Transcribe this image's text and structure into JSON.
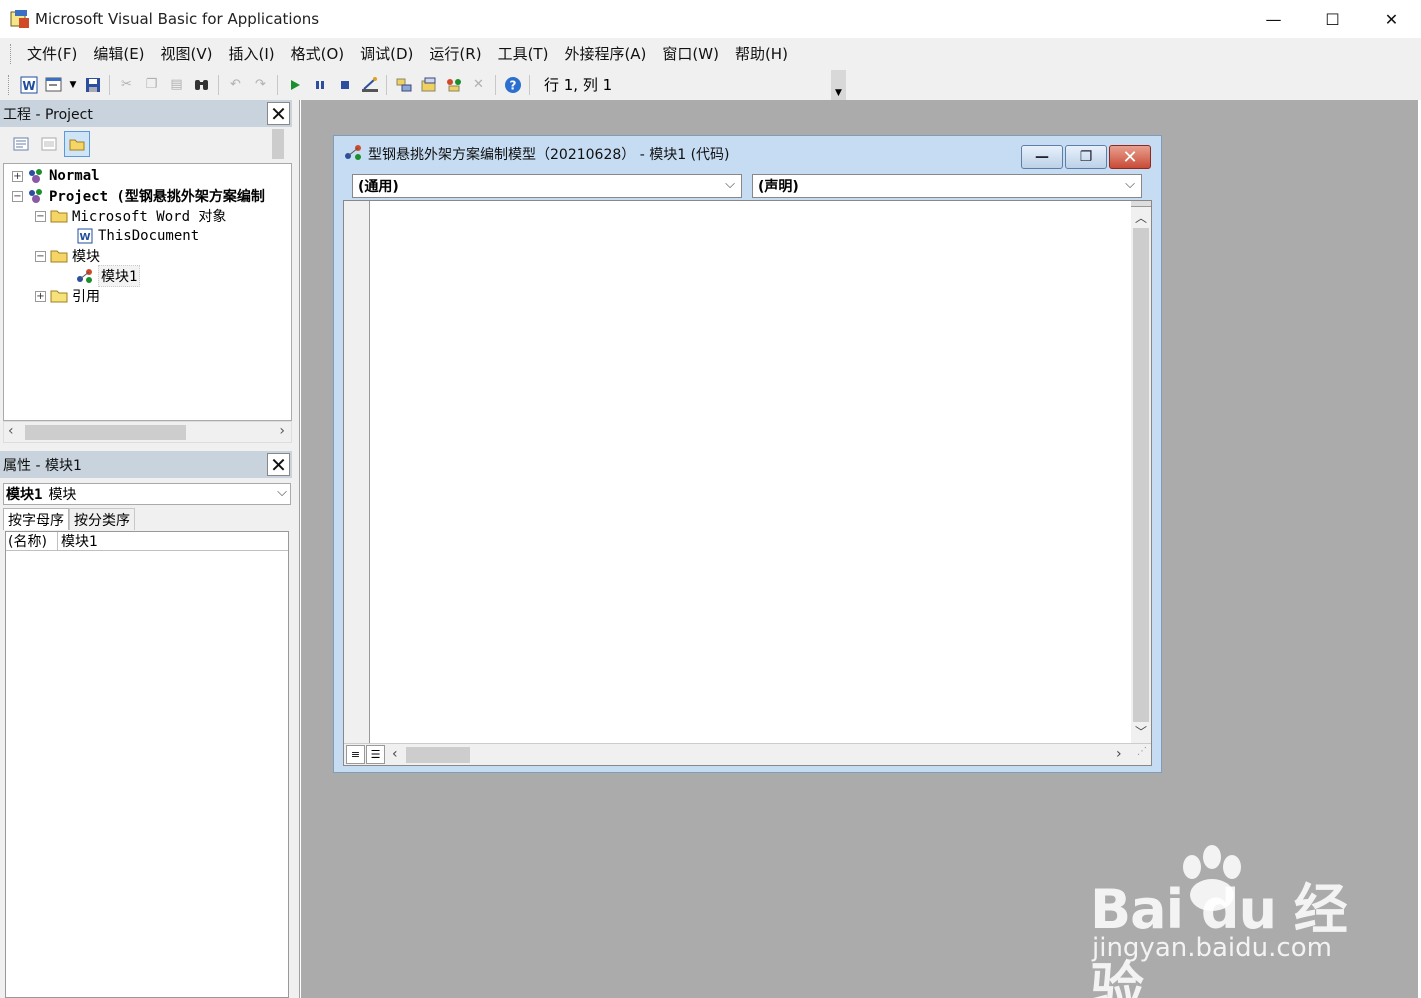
{
  "window": {
    "title": "Microsoft Visual Basic for Applications",
    "minimize": "—",
    "maximize": "☐",
    "close": "✕"
  },
  "menu": {
    "items": [
      "文件(F)",
      "编辑(E)",
      "视图(V)",
      "插入(I)",
      "格式(O)",
      "调试(D)",
      "运行(R)",
      "工具(T)",
      "外接程序(A)",
      "窗口(W)",
      "帮助(H)"
    ]
  },
  "toolbar": {
    "cursor_position": "行 1, 列 1"
  },
  "project_pane": {
    "title": "工程 - Project",
    "close_label": "✕",
    "tree": [
      {
        "label": "Normal",
        "toggle": "+"
      },
      {
        "label": "Project (型钢悬挑外架方案编制",
        "toggle": "−"
      },
      {
        "label": "Microsoft Word 对象",
        "toggle": "−"
      },
      {
        "label": "ThisDocument"
      },
      {
        "label": "模块",
        "toggle": "−"
      },
      {
        "label": "模块1"
      },
      {
        "label": "引用",
        "toggle": "+"
      }
    ]
  },
  "properties_pane": {
    "title": "属性 - 模块1",
    "close_label": "✕",
    "object_select": {
      "name": "模块1",
      "type": "模块"
    },
    "tabs": [
      "按字母序",
      "按分类序"
    ],
    "rows": [
      {
        "name": "(名称)",
        "value": "模块1"
      }
    ]
  },
  "code_window": {
    "title": "型钢悬挑外架方案编制模型（20210628） - 模块1 (代码)",
    "object_combo": "(通用)",
    "procedure_combo": "(声明)",
    "minimize": "—",
    "restore": "❐",
    "close": "✕"
  },
  "watermark": {
    "logo": "Bai du 经验",
    "url": "jingyan.baidu.com"
  }
}
